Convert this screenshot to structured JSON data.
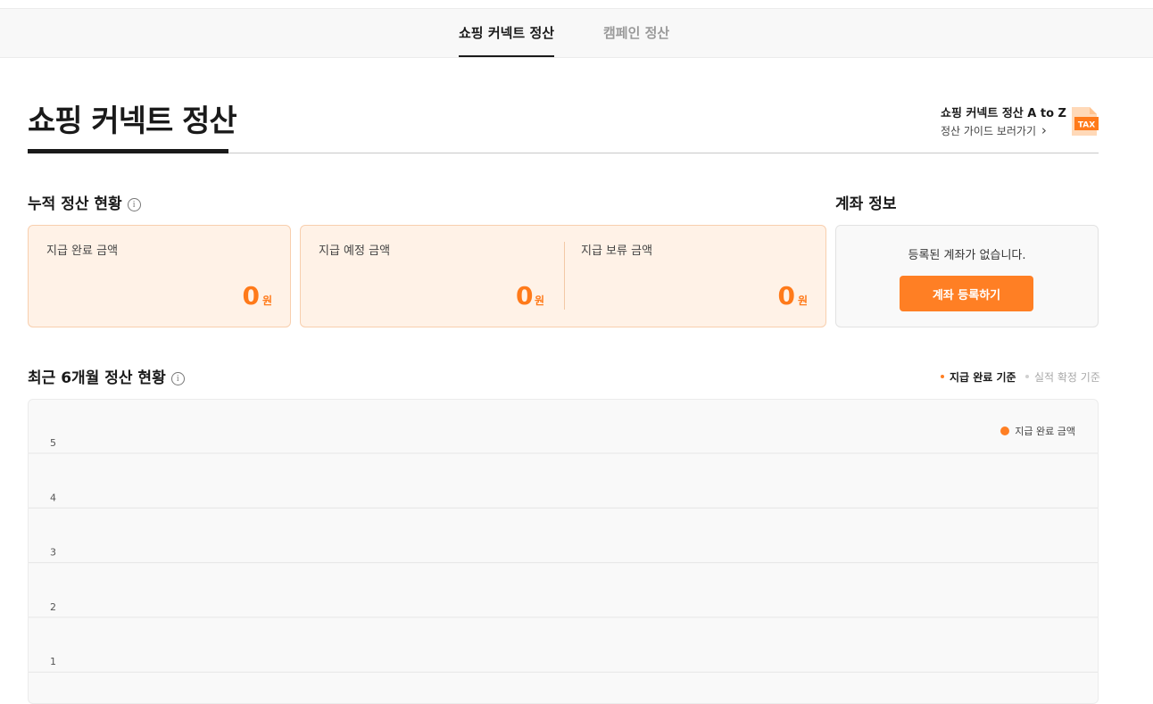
{
  "tabs": [
    {
      "label": "쇼핑 커넥트 정산",
      "active": true
    },
    {
      "label": "캠페인 정산",
      "active": false
    }
  ],
  "header": {
    "title": "쇼핑 커넥트 정산",
    "guide_title": "쇼핑 커넥트 정산 A to Z",
    "guide_link": "정산 가이드 보러가기",
    "guide_link_arrow": "›",
    "guide_icon_text": "TAX"
  },
  "cumulative": {
    "title": "누적 정산 현황",
    "info_glyph": "i",
    "paid": {
      "label": "지급 완료 금액",
      "amount": "0",
      "unit": "원"
    },
    "scheduled": {
      "label": "지급 예정 금액",
      "amount": "0",
      "unit": "원"
    },
    "held": {
      "label": "지급 보류 금액",
      "amount": "0",
      "unit": "원"
    }
  },
  "account": {
    "title": "계좌 정보",
    "message": "등록된 계좌가 없습니다.",
    "button_label": "계좌 등록하기"
  },
  "recent": {
    "title": "최근 6개월 정산 현황",
    "info_glyph": "i",
    "toggle_options": [
      {
        "label": "지급 완료 기준",
        "selected": true
      },
      {
        "label": "실적 확정 기준",
        "selected": false
      }
    ]
  },
  "colors": {
    "accent": "#ff7f24",
    "accent_text": "#ff7a1a",
    "card_bg": "#fff2e7",
    "card_border": "#f8cfae"
  },
  "chart_data": {
    "type": "bar",
    "series": [
      {
        "name": "지급 완료 금액",
        "values": []
      }
    ],
    "categories": [],
    "y_ticks": [
      "5",
      "4",
      "3",
      "2",
      "1"
    ],
    "ylim": [
      0,
      5
    ],
    "grid": true,
    "legend": "top-right"
  }
}
